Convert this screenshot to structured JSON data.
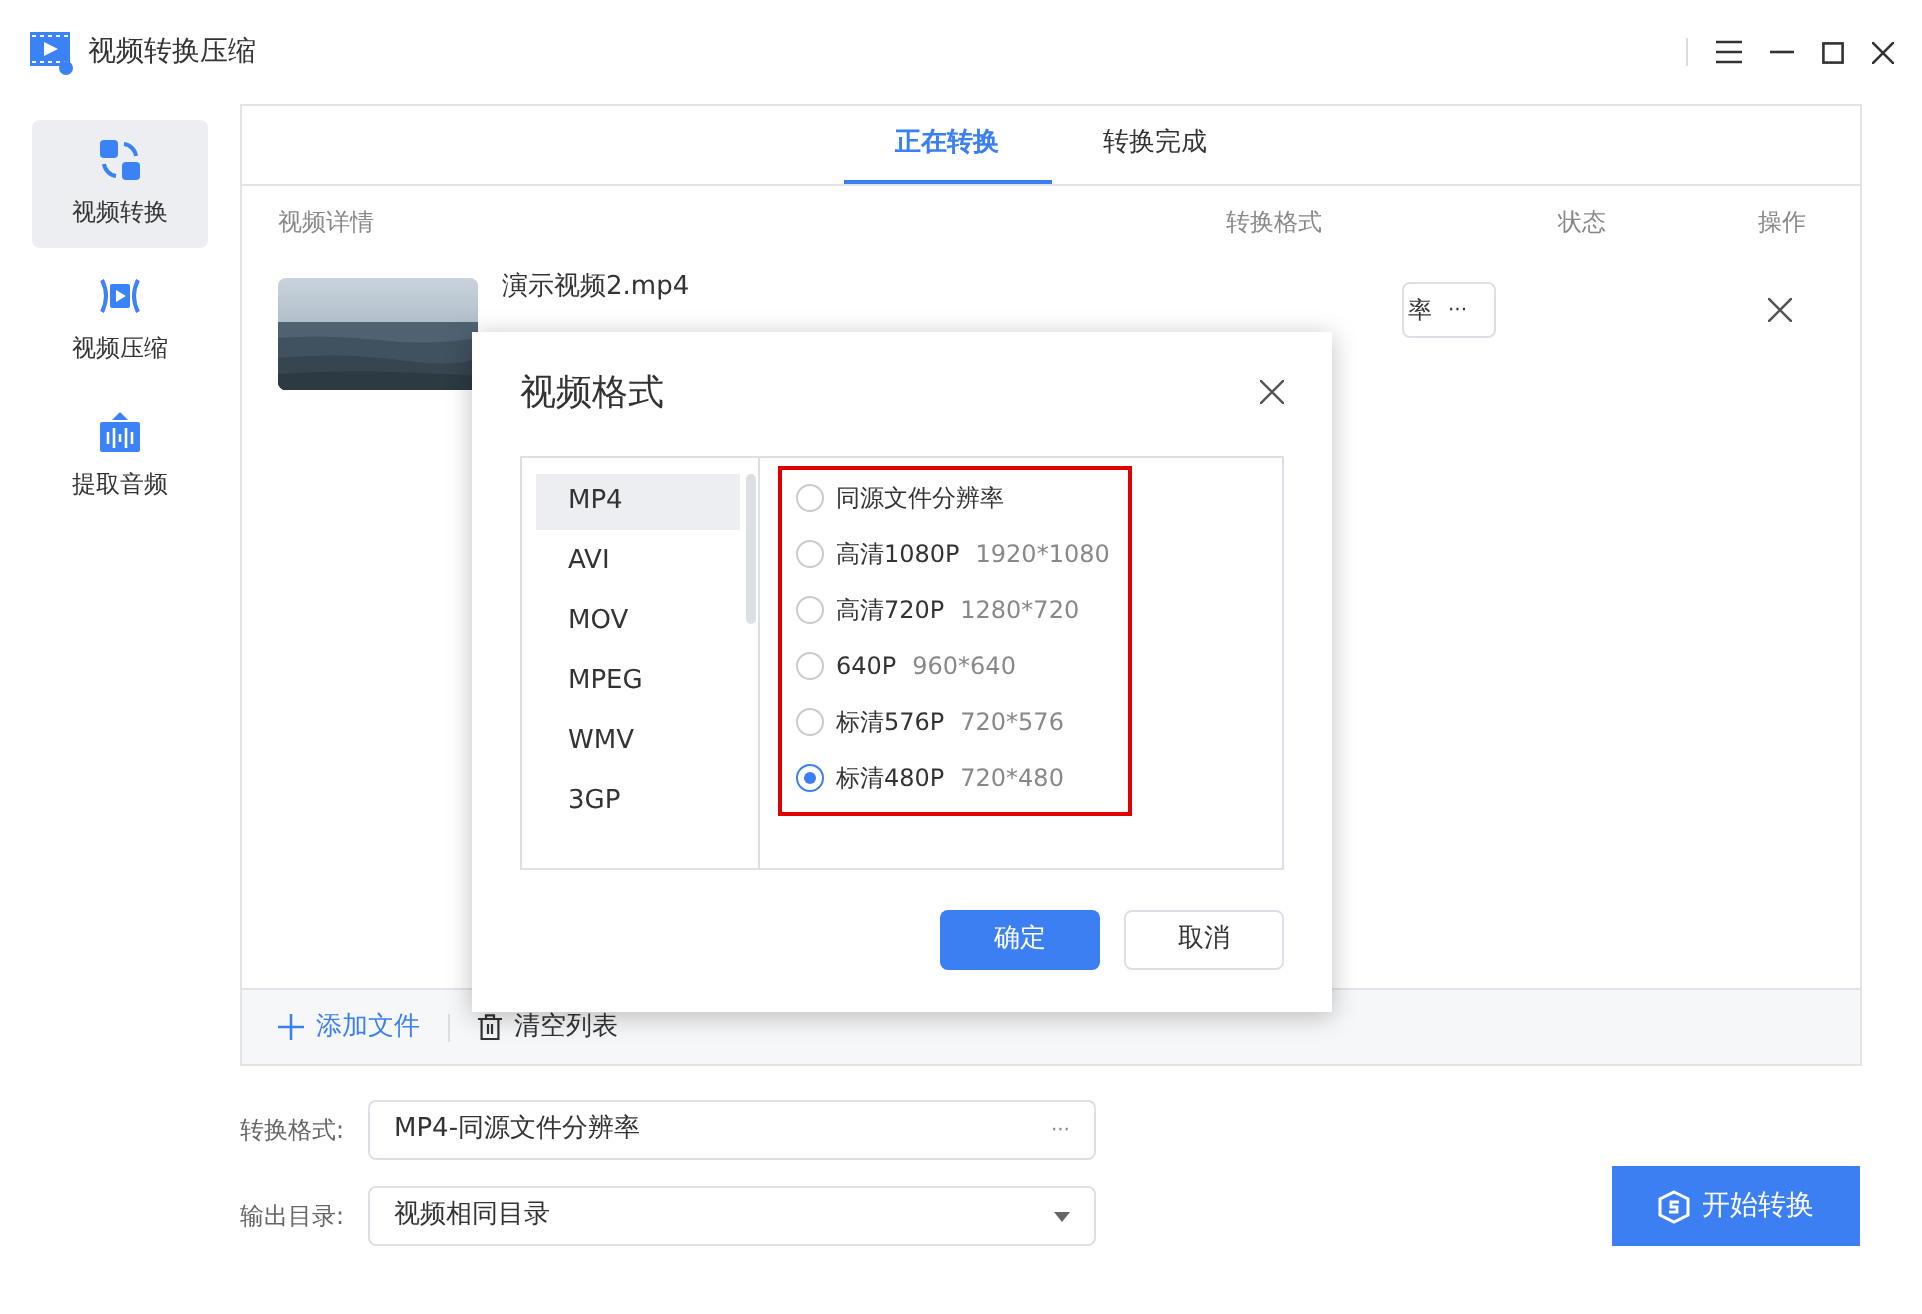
{
  "window": {
    "title": "视频转换压缩"
  },
  "sidebar": {
    "items": [
      {
        "label": "视频转换",
        "selected": true,
        "kind": "convert"
      },
      {
        "label": "视频压缩",
        "selected": false,
        "kind": "compress"
      },
      {
        "label": "提取音频",
        "selected": false,
        "kind": "audio"
      }
    ]
  },
  "tabs": [
    {
      "label": "正在转换",
      "selected": true
    },
    {
      "label": "转换完成",
      "selected": false
    }
  ],
  "table": {
    "columns": [
      "视频详情",
      "转换格式",
      "状态",
      "操作"
    ],
    "rows": [
      {
        "file_name": "演示视频2.mp4",
        "format": "率",
        "more": "···"
      }
    ]
  },
  "footer": {
    "add_file": "添加文件",
    "clear_list": "清空列表"
  },
  "form": {
    "format_label": "转换格式:",
    "format_value": "MP4-同源文件分辨率",
    "format_more": "···",
    "output_label": "输出目录:",
    "output_value": "视频相同目录"
  },
  "start_button": "开始转换",
  "dialog": {
    "title": "视频格式",
    "formats": [
      {
        "label": "MP4",
        "selected": true
      },
      {
        "label": "AVI",
        "selected": false
      },
      {
        "label": "MOV",
        "selected": false
      },
      {
        "label": "MPEG",
        "selected": false
      },
      {
        "label": "WMV",
        "selected": false
      },
      {
        "label": "3GP",
        "selected": false
      }
    ],
    "resolutions": [
      {
        "label": "同源文件分辨率",
        "selected": false
      },
      {
        "label": "高清1080P",
        "size": "1920*1080",
        "selected": false
      },
      {
        "label": "高清720P",
        "size": "1280*720",
        "selected": false
      },
      {
        "label": "640P",
        "size": "960*640",
        "selected": false
      },
      {
        "label": "标清576P",
        "size": "720*576",
        "selected": false
      },
      {
        "label": "标清480P",
        "size": "720*480",
        "selected": true
      }
    ],
    "ok": "确定",
    "cancel": "取消"
  }
}
